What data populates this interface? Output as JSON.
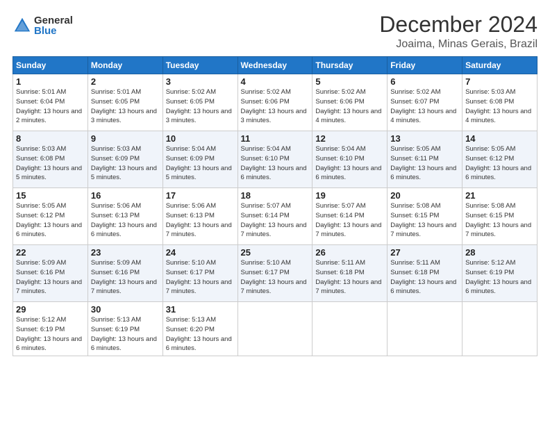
{
  "logo": {
    "general": "General",
    "blue": "Blue"
  },
  "title": "December 2024",
  "location": "Joaima, Minas Gerais, Brazil",
  "days_header": [
    "Sunday",
    "Monday",
    "Tuesday",
    "Wednesday",
    "Thursday",
    "Friday",
    "Saturday"
  ],
  "weeks": [
    [
      {
        "day": "1",
        "rise": "Sunrise: 5:01 AM",
        "set": "Sunset: 6:04 PM",
        "daylight": "Daylight: 13 hours and 2 minutes."
      },
      {
        "day": "2",
        "rise": "Sunrise: 5:01 AM",
        "set": "Sunset: 6:05 PM",
        "daylight": "Daylight: 13 hours and 3 minutes."
      },
      {
        "day": "3",
        "rise": "Sunrise: 5:02 AM",
        "set": "Sunset: 6:05 PM",
        "daylight": "Daylight: 13 hours and 3 minutes."
      },
      {
        "day": "4",
        "rise": "Sunrise: 5:02 AM",
        "set": "Sunset: 6:06 PM",
        "daylight": "Daylight: 13 hours and 3 minutes."
      },
      {
        "day": "5",
        "rise": "Sunrise: 5:02 AM",
        "set": "Sunset: 6:06 PM",
        "daylight": "Daylight: 13 hours and 4 minutes."
      },
      {
        "day": "6",
        "rise": "Sunrise: 5:02 AM",
        "set": "Sunset: 6:07 PM",
        "daylight": "Daylight: 13 hours and 4 minutes."
      },
      {
        "day": "7",
        "rise": "Sunrise: 5:03 AM",
        "set": "Sunset: 6:08 PM",
        "daylight": "Daylight: 13 hours and 4 minutes."
      }
    ],
    [
      {
        "day": "8",
        "rise": "Sunrise: 5:03 AM",
        "set": "Sunset: 6:08 PM",
        "daylight": "Daylight: 13 hours and 5 minutes."
      },
      {
        "day": "9",
        "rise": "Sunrise: 5:03 AM",
        "set": "Sunset: 6:09 PM",
        "daylight": "Daylight: 13 hours and 5 minutes."
      },
      {
        "day": "10",
        "rise": "Sunrise: 5:04 AM",
        "set": "Sunset: 6:09 PM",
        "daylight": "Daylight: 13 hours and 5 minutes."
      },
      {
        "day": "11",
        "rise": "Sunrise: 5:04 AM",
        "set": "Sunset: 6:10 PM",
        "daylight": "Daylight: 13 hours and 6 minutes."
      },
      {
        "day": "12",
        "rise": "Sunrise: 5:04 AM",
        "set": "Sunset: 6:10 PM",
        "daylight": "Daylight: 13 hours and 6 minutes."
      },
      {
        "day": "13",
        "rise": "Sunrise: 5:05 AM",
        "set": "Sunset: 6:11 PM",
        "daylight": "Daylight: 13 hours and 6 minutes."
      },
      {
        "day": "14",
        "rise": "Sunrise: 5:05 AM",
        "set": "Sunset: 6:12 PM",
        "daylight": "Daylight: 13 hours and 6 minutes."
      }
    ],
    [
      {
        "day": "15",
        "rise": "Sunrise: 5:05 AM",
        "set": "Sunset: 6:12 PM",
        "daylight": "Daylight: 13 hours and 6 minutes."
      },
      {
        "day": "16",
        "rise": "Sunrise: 5:06 AM",
        "set": "Sunset: 6:13 PM",
        "daylight": "Daylight: 13 hours and 6 minutes."
      },
      {
        "day": "17",
        "rise": "Sunrise: 5:06 AM",
        "set": "Sunset: 6:13 PM",
        "daylight": "Daylight: 13 hours and 7 minutes."
      },
      {
        "day": "18",
        "rise": "Sunrise: 5:07 AM",
        "set": "Sunset: 6:14 PM",
        "daylight": "Daylight: 13 hours and 7 minutes."
      },
      {
        "day": "19",
        "rise": "Sunrise: 5:07 AM",
        "set": "Sunset: 6:14 PM",
        "daylight": "Daylight: 13 hours and 7 minutes."
      },
      {
        "day": "20",
        "rise": "Sunrise: 5:08 AM",
        "set": "Sunset: 6:15 PM",
        "daylight": "Daylight: 13 hours and 7 minutes."
      },
      {
        "day": "21",
        "rise": "Sunrise: 5:08 AM",
        "set": "Sunset: 6:15 PM",
        "daylight": "Daylight: 13 hours and 7 minutes."
      }
    ],
    [
      {
        "day": "22",
        "rise": "Sunrise: 5:09 AM",
        "set": "Sunset: 6:16 PM",
        "daylight": "Daylight: 13 hours and 7 minutes."
      },
      {
        "day": "23",
        "rise": "Sunrise: 5:09 AM",
        "set": "Sunset: 6:16 PM",
        "daylight": "Daylight: 13 hours and 7 minutes."
      },
      {
        "day": "24",
        "rise": "Sunrise: 5:10 AM",
        "set": "Sunset: 6:17 PM",
        "daylight": "Daylight: 13 hours and 7 minutes."
      },
      {
        "day": "25",
        "rise": "Sunrise: 5:10 AM",
        "set": "Sunset: 6:17 PM",
        "daylight": "Daylight: 13 hours and 7 minutes."
      },
      {
        "day": "26",
        "rise": "Sunrise: 5:11 AM",
        "set": "Sunset: 6:18 PM",
        "daylight": "Daylight: 13 hours and 7 minutes."
      },
      {
        "day": "27",
        "rise": "Sunrise: 5:11 AM",
        "set": "Sunset: 6:18 PM",
        "daylight": "Daylight: 13 hours and 6 minutes."
      },
      {
        "day": "28",
        "rise": "Sunrise: 5:12 AM",
        "set": "Sunset: 6:19 PM",
        "daylight": "Daylight: 13 hours and 6 minutes."
      }
    ],
    [
      {
        "day": "29",
        "rise": "Sunrise: 5:12 AM",
        "set": "Sunset: 6:19 PM",
        "daylight": "Daylight: 13 hours and 6 minutes."
      },
      {
        "day": "30",
        "rise": "Sunrise: 5:13 AM",
        "set": "Sunset: 6:19 PM",
        "daylight": "Daylight: 13 hours and 6 minutes."
      },
      {
        "day": "31",
        "rise": "Sunrise: 5:13 AM",
        "set": "Sunset: 6:20 PM",
        "daylight": "Daylight: 13 hours and 6 minutes."
      },
      null,
      null,
      null,
      null
    ]
  ]
}
